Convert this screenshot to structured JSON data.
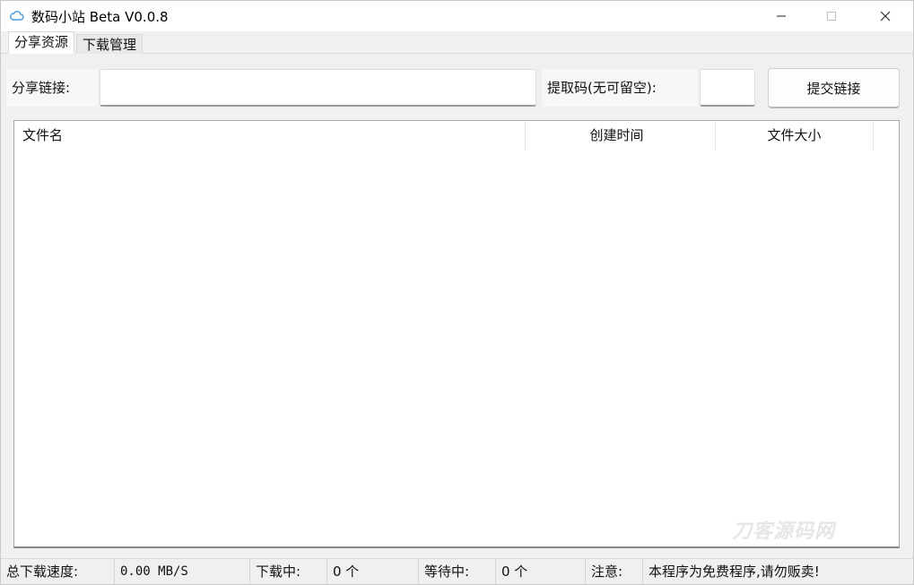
{
  "window": {
    "title": "数码小站 Beta V0.0.8",
    "icon": "cloud-icon",
    "controls": {
      "minimize_icon": "minimize-icon",
      "maximize_icon": "maximize-icon",
      "close_icon": "close-icon"
    }
  },
  "tabs": [
    {
      "label": "分享资源",
      "active": true
    },
    {
      "label": "下载管理",
      "active": false
    }
  ],
  "form": {
    "share_link_label": "分享链接:",
    "share_link_value": "",
    "extract_code_label": "提取码(无可留空):",
    "extract_code_value": "",
    "submit_label": "提交链接"
  },
  "file_list": {
    "columns": [
      "文件名",
      "创建时间",
      "文件大小"
    ],
    "rows": []
  },
  "watermark": "刀客源码网",
  "status": {
    "speed_label": "总下载速度:",
    "speed_value": "0.00 MB/S",
    "downloading_label": "下载中:",
    "downloading_value": "0 个",
    "waiting_label": "等待中:",
    "waiting_value": "0 个",
    "notice_label": "注意:",
    "notice_text": "本程序为免费程序,请勿贩卖!"
  },
  "colors": {
    "window_bg": "#f0f0f0",
    "titlebar_bg": "#ffffff",
    "icon_accent": "#4a9be0"
  }
}
